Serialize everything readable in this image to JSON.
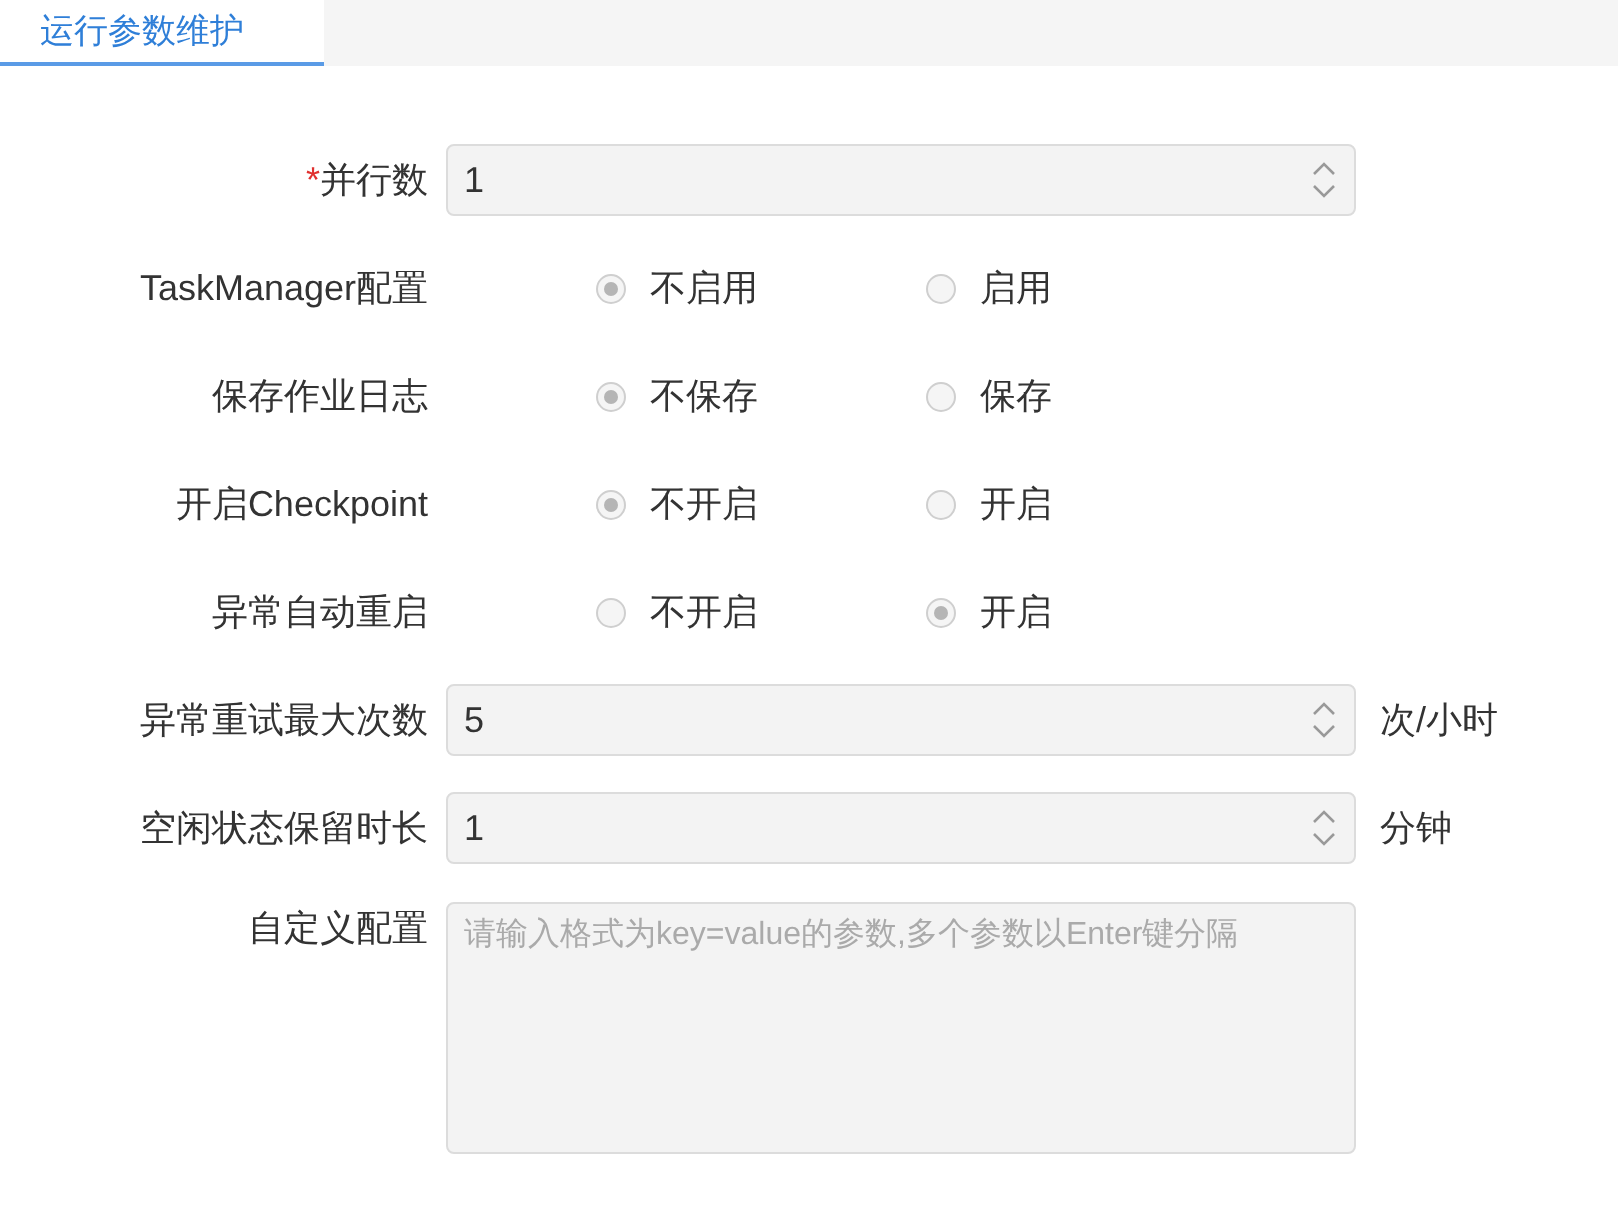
{
  "tabs": [
    {
      "label": "运行参数维护",
      "selected": true
    }
  ],
  "form": [
    {
      "kind": "number",
      "required_mark": "*",
      "label": "并行数",
      "value": "1"
    },
    {
      "kind": "radio",
      "label": "TaskManager配置",
      "options": [
        {
          "label": "不启用",
          "selected": true
        },
        {
          "label": "启用",
          "selected": false
        }
      ]
    },
    {
      "kind": "radio",
      "label": "保存作业日志",
      "options": [
        {
          "label": "不保存",
          "selected": true
        },
        {
          "label": "保存",
          "selected": false
        }
      ]
    },
    {
      "kind": "radio",
      "label": "开启Checkpoint",
      "options": [
        {
          "label": "不开启",
          "selected": true
        },
        {
          "label": "开启",
          "selected": false
        }
      ]
    },
    {
      "kind": "radio",
      "label": "异常自动重启",
      "options": [
        {
          "label": "不开启",
          "selected": false
        },
        {
          "label": "开启",
          "selected": true
        }
      ]
    },
    {
      "kind": "number",
      "label": "异常重试最大次数",
      "value": "5",
      "unit": "次/小时"
    },
    {
      "kind": "number",
      "label": "空闲状态保留时长",
      "value": "1",
      "unit": "分钟"
    },
    {
      "kind": "textarea",
      "label": "自定义配置",
      "placeholder": "请输入格式为key=value的参数,多个参数以Enter键分隔"
    }
  ]
}
